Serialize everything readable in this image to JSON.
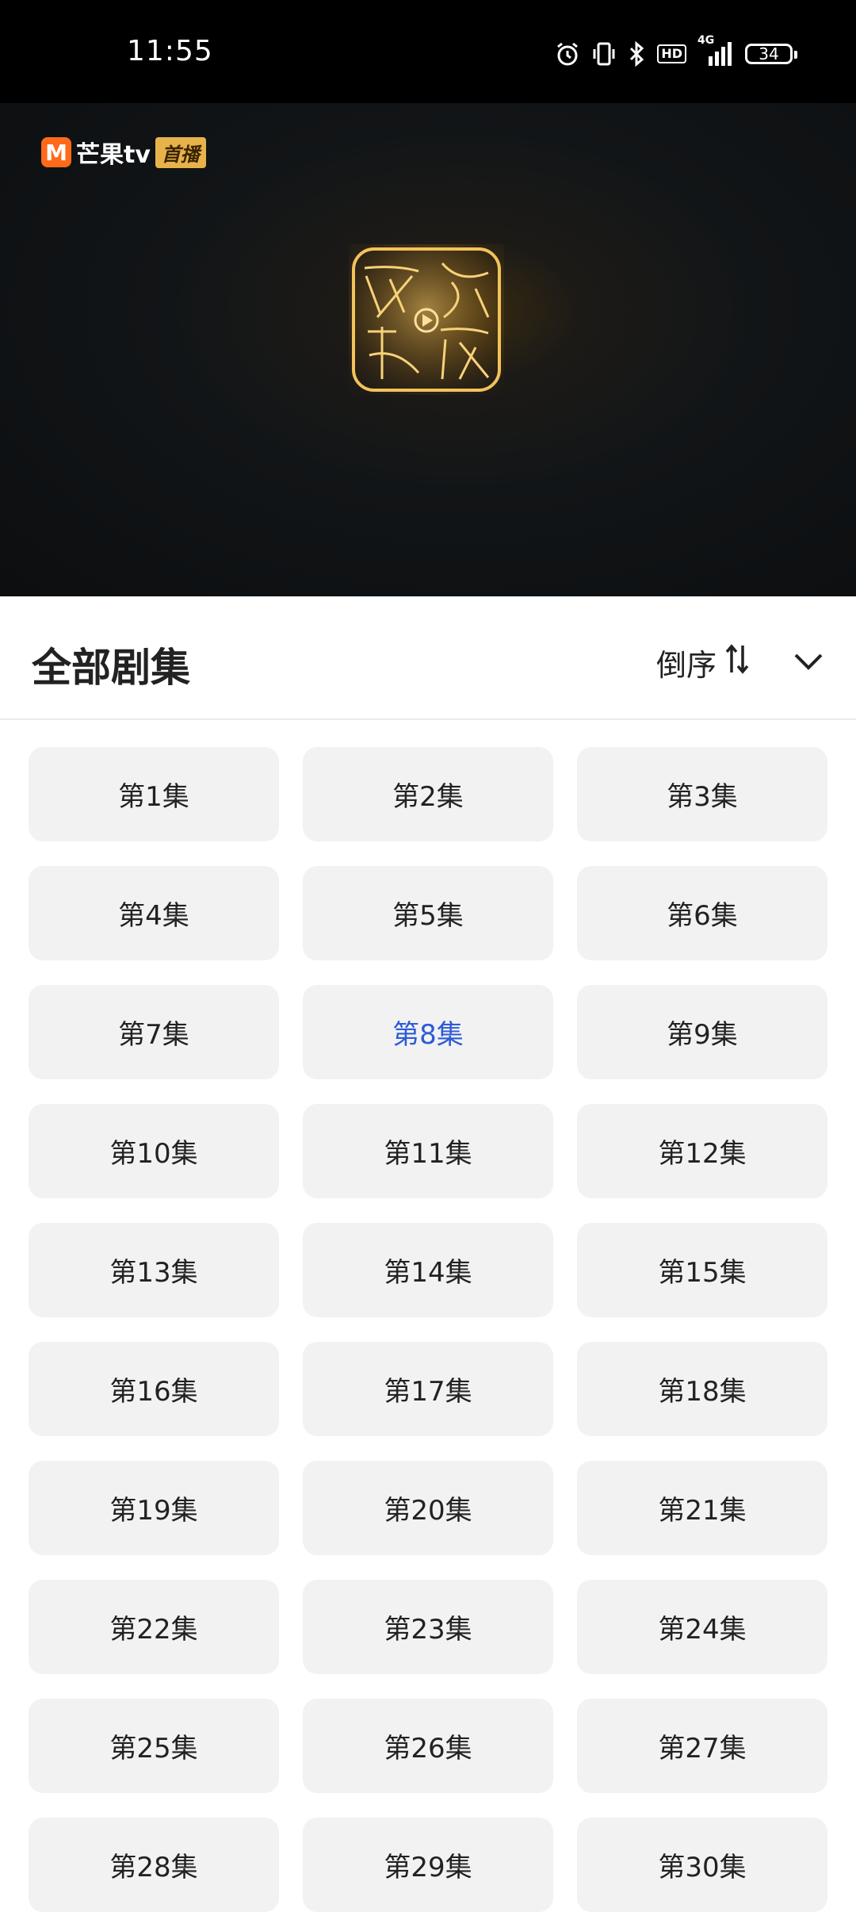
{
  "status_bar": {
    "time": "11:55",
    "icons": [
      "alarm-icon",
      "vibrate-icon",
      "bluetooth-icon",
      "hd-icon",
      "signal-4g-icon",
      "battery-icon"
    ],
    "hd_label": "HD",
    "network_label": "4G",
    "battery_level": "34"
  },
  "video": {
    "brand_name": "芒果tv",
    "brand_tag": "首播",
    "watermark_icon": "network-video-seal-logo"
  },
  "episodes": {
    "title": "全部剧集",
    "sort_label": "倒序",
    "sort_icon": "sort-arrows-icon",
    "collapse_icon": "chevron-down-icon",
    "active_color": "#2d5bd6",
    "active_index": 7,
    "items": [
      {
        "label": "第1集"
      },
      {
        "label": "第2集"
      },
      {
        "label": "第3集"
      },
      {
        "label": "第4集"
      },
      {
        "label": "第5集"
      },
      {
        "label": "第6集"
      },
      {
        "label": "第7集"
      },
      {
        "label": "第8集"
      },
      {
        "label": "第9集"
      },
      {
        "label": "第10集"
      },
      {
        "label": "第11集"
      },
      {
        "label": "第12集"
      },
      {
        "label": "第13集"
      },
      {
        "label": "第14集"
      },
      {
        "label": "第15集"
      },
      {
        "label": "第16集"
      },
      {
        "label": "第17集"
      },
      {
        "label": "第18集"
      },
      {
        "label": "第19集"
      },
      {
        "label": "第20集"
      },
      {
        "label": "第21集"
      },
      {
        "label": "第22集"
      },
      {
        "label": "第23集"
      },
      {
        "label": "第24集"
      },
      {
        "label": "第25集"
      },
      {
        "label": "第26集"
      },
      {
        "label": "第27集"
      },
      {
        "label": "第28集"
      },
      {
        "label": "第29集"
      },
      {
        "label": "第30集"
      }
    ]
  }
}
